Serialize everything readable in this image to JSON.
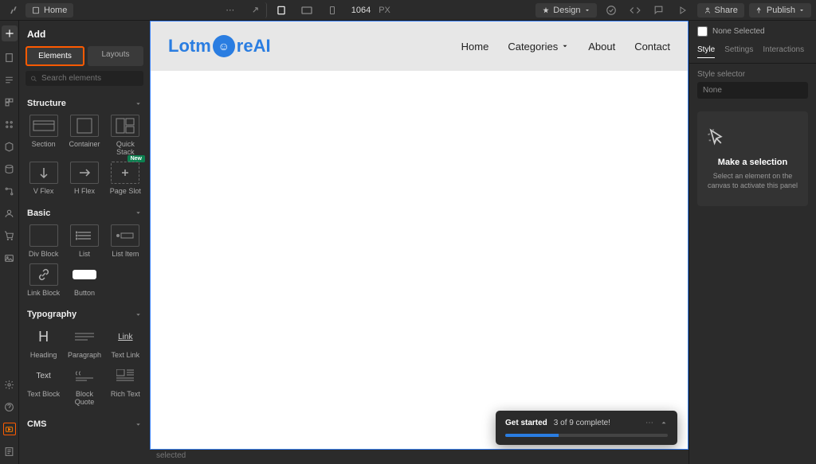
{
  "topbar": {
    "page_name": "Home",
    "width": "1064",
    "unit": "PX",
    "design_btn": "Design",
    "share_btn": "Share",
    "publish_btn": "Publish"
  },
  "panel": {
    "title": "Add",
    "tab_elements": "Elements",
    "tab_layouts": "Layouts",
    "search_placeholder": "Search elements",
    "sections": {
      "structure": {
        "title": "Structure",
        "items": [
          "Section",
          "Container",
          "Quick Stack",
          "V Flex",
          "H Flex",
          "Page Slot"
        ],
        "new_badge": "New"
      },
      "basic": {
        "title": "Basic",
        "items": [
          "Div Block",
          "List",
          "List Item",
          "Link Block",
          "Button"
        ]
      },
      "typography": {
        "title": "Typography",
        "items": [
          "Heading",
          "Paragraph",
          "Text Link",
          "Text Block",
          "Block Quote",
          "Rich Text"
        ]
      },
      "cms": {
        "title": "CMS"
      }
    }
  },
  "canvas": {
    "logo_left": "Lotm",
    "logo_right": "reAI",
    "nav": [
      "Home",
      "Categories",
      "About",
      "Contact"
    ],
    "status": "selected"
  },
  "toast": {
    "title": "Get started",
    "subtitle": "3 of 9 complete!",
    "progress_pct": 33
  },
  "right": {
    "none_selected": "None Selected",
    "tabs": [
      "Style",
      "Settings",
      "Interactions"
    ],
    "selector_label": "Style selector",
    "selector_value": "None",
    "empty_title": "Make a selection",
    "empty_body": "Select an element on the canvas to activate this panel"
  }
}
